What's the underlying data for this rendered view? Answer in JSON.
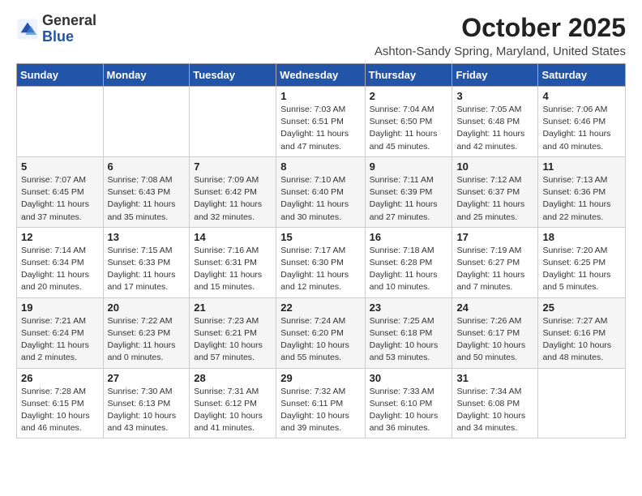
{
  "header": {
    "logo_general": "General",
    "logo_blue": "Blue",
    "month": "October 2025",
    "location": "Ashton-Sandy Spring, Maryland, United States"
  },
  "days_of_week": [
    "Sunday",
    "Monday",
    "Tuesday",
    "Wednesday",
    "Thursday",
    "Friday",
    "Saturday"
  ],
  "weeks": [
    [
      {
        "day": "",
        "info": ""
      },
      {
        "day": "",
        "info": ""
      },
      {
        "day": "",
        "info": ""
      },
      {
        "day": "1",
        "info": "Sunrise: 7:03 AM\nSunset: 6:51 PM\nDaylight: 11 hours and 47 minutes."
      },
      {
        "day": "2",
        "info": "Sunrise: 7:04 AM\nSunset: 6:50 PM\nDaylight: 11 hours and 45 minutes."
      },
      {
        "day": "3",
        "info": "Sunrise: 7:05 AM\nSunset: 6:48 PM\nDaylight: 11 hours and 42 minutes."
      },
      {
        "day": "4",
        "info": "Sunrise: 7:06 AM\nSunset: 6:46 PM\nDaylight: 11 hours and 40 minutes."
      }
    ],
    [
      {
        "day": "5",
        "info": "Sunrise: 7:07 AM\nSunset: 6:45 PM\nDaylight: 11 hours and 37 minutes."
      },
      {
        "day": "6",
        "info": "Sunrise: 7:08 AM\nSunset: 6:43 PM\nDaylight: 11 hours and 35 minutes."
      },
      {
        "day": "7",
        "info": "Sunrise: 7:09 AM\nSunset: 6:42 PM\nDaylight: 11 hours and 32 minutes."
      },
      {
        "day": "8",
        "info": "Sunrise: 7:10 AM\nSunset: 6:40 PM\nDaylight: 11 hours and 30 minutes."
      },
      {
        "day": "9",
        "info": "Sunrise: 7:11 AM\nSunset: 6:39 PM\nDaylight: 11 hours and 27 minutes."
      },
      {
        "day": "10",
        "info": "Sunrise: 7:12 AM\nSunset: 6:37 PM\nDaylight: 11 hours and 25 minutes."
      },
      {
        "day": "11",
        "info": "Sunrise: 7:13 AM\nSunset: 6:36 PM\nDaylight: 11 hours and 22 minutes."
      }
    ],
    [
      {
        "day": "12",
        "info": "Sunrise: 7:14 AM\nSunset: 6:34 PM\nDaylight: 11 hours and 20 minutes."
      },
      {
        "day": "13",
        "info": "Sunrise: 7:15 AM\nSunset: 6:33 PM\nDaylight: 11 hours and 17 minutes."
      },
      {
        "day": "14",
        "info": "Sunrise: 7:16 AM\nSunset: 6:31 PM\nDaylight: 11 hours and 15 minutes."
      },
      {
        "day": "15",
        "info": "Sunrise: 7:17 AM\nSunset: 6:30 PM\nDaylight: 11 hours and 12 minutes."
      },
      {
        "day": "16",
        "info": "Sunrise: 7:18 AM\nSunset: 6:28 PM\nDaylight: 11 hours and 10 minutes."
      },
      {
        "day": "17",
        "info": "Sunrise: 7:19 AM\nSunset: 6:27 PM\nDaylight: 11 hours and 7 minutes."
      },
      {
        "day": "18",
        "info": "Sunrise: 7:20 AM\nSunset: 6:25 PM\nDaylight: 11 hours and 5 minutes."
      }
    ],
    [
      {
        "day": "19",
        "info": "Sunrise: 7:21 AM\nSunset: 6:24 PM\nDaylight: 11 hours and 2 minutes."
      },
      {
        "day": "20",
        "info": "Sunrise: 7:22 AM\nSunset: 6:23 PM\nDaylight: 11 hours and 0 minutes."
      },
      {
        "day": "21",
        "info": "Sunrise: 7:23 AM\nSunset: 6:21 PM\nDaylight: 10 hours and 57 minutes."
      },
      {
        "day": "22",
        "info": "Sunrise: 7:24 AM\nSunset: 6:20 PM\nDaylight: 10 hours and 55 minutes."
      },
      {
        "day": "23",
        "info": "Sunrise: 7:25 AM\nSunset: 6:18 PM\nDaylight: 10 hours and 53 minutes."
      },
      {
        "day": "24",
        "info": "Sunrise: 7:26 AM\nSunset: 6:17 PM\nDaylight: 10 hours and 50 minutes."
      },
      {
        "day": "25",
        "info": "Sunrise: 7:27 AM\nSunset: 6:16 PM\nDaylight: 10 hours and 48 minutes."
      }
    ],
    [
      {
        "day": "26",
        "info": "Sunrise: 7:28 AM\nSunset: 6:15 PM\nDaylight: 10 hours and 46 minutes."
      },
      {
        "day": "27",
        "info": "Sunrise: 7:30 AM\nSunset: 6:13 PM\nDaylight: 10 hours and 43 minutes."
      },
      {
        "day": "28",
        "info": "Sunrise: 7:31 AM\nSunset: 6:12 PM\nDaylight: 10 hours and 41 minutes."
      },
      {
        "day": "29",
        "info": "Sunrise: 7:32 AM\nSunset: 6:11 PM\nDaylight: 10 hours and 39 minutes."
      },
      {
        "day": "30",
        "info": "Sunrise: 7:33 AM\nSunset: 6:10 PM\nDaylight: 10 hours and 36 minutes."
      },
      {
        "day": "31",
        "info": "Sunrise: 7:34 AM\nSunset: 6:08 PM\nDaylight: 10 hours and 34 minutes."
      },
      {
        "day": "",
        "info": ""
      }
    ]
  ]
}
